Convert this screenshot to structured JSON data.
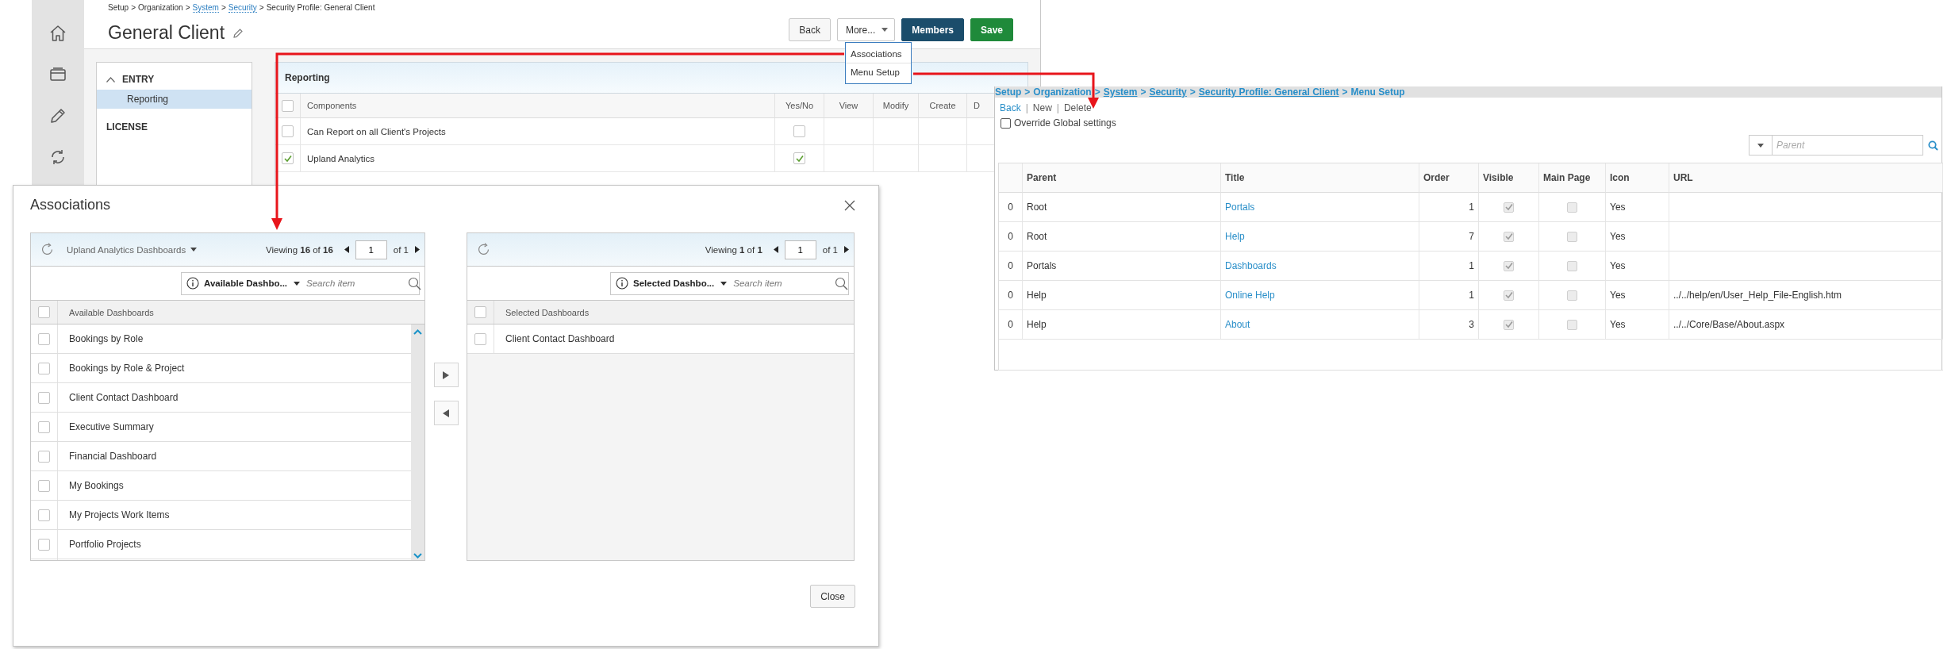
{
  "app": {
    "breadcrumb": {
      "separator": ">",
      "items": [
        {
          "text": "Setup",
          "link": false
        },
        {
          "text": "Organization",
          "link": false
        },
        {
          "text": "System",
          "link": true
        },
        {
          "text": "Security",
          "link": true
        },
        {
          "text": "Security Profile: General Client",
          "link": false
        }
      ]
    },
    "title": "General Client",
    "buttons": [
      {
        "label": "Back",
        "kind": "default"
      },
      {
        "label": "More...",
        "kind": "dropdown"
      },
      {
        "label": "Members",
        "kind": "primary"
      },
      {
        "label": "Save",
        "kind": "success"
      }
    ],
    "more_menu": [
      "Associations",
      "Menu Setup"
    ],
    "nav": [
      {
        "label": "ENTRY",
        "expanded": true,
        "children": [
          {
            "label": "Reporting",
            "selected": true
          }
        ]
      },
      {
        "label": "LICENSE"
      }
    ],
    "panel": {
      "title": "Reporting",
      "all_checked": false,
      "columns": [
        "Components",
        "Yes/No",
        "View",
        "Modify",
        "Create",
        "D"
      ],
      "rows": [
        {
          "name": "Can Report on all Client's Projects",
          "checked": false,
          "yes_no": false
        },
        {
          "name": "Upland Analytics",
          "checked": true,
          "yes_no": true
        }
      ]
    }
  },
  "associations": {
    "title": "Associations",
    "panes": [
      {
        "kind": "source",
        "category": "Upland Analytics Dashboards",
        "viewing": "Viewing **16** of **16**",
        "page": "1",
        "page_total": "of 1",
        "filter": "Available Dashbo...",
        "search": {
          "placeholder": "Search item"
        },
        "column": "Available Dashboards",
        "all_checked": false,
        "items": [
          {
            "label": "Bookings by Role",
            "checked": false
          },
          {
            "label": "Bookings by Role & Project",
            "checked": false
          },
          {
            "label": "Client Contact Dashboard",
            "checked": false
          },
          {
            "label": "Executive Summary",
            "checked": false
          },
          {
            "label": "Financial Dashboard",
            "checked": false
          },
          {
            "label": "My Bookings",
            "checked": false
          },
          {
            "label": "My Projects Work Items",
            "checked": false
          },
          {
            "label": "Portfolio Projects",
            "checked": false
          }
        ]
      },
      {
        "kind": "target",
        "viewing": "Viewing **1** of **1**",
        "page": "1",
        "page_total": "of 1",
        "filter": "Selected Dashbo...",
        "search": {
          "placeholder": "Search item"
        },
        "column": "Selected Dashboards",
        "all_checked": false,
        "items": [
          {
            "label": "Client Contact Dashboard",
            "checked": false
          }
        ]
      }
    ],
    "close": "Close"
  },
  "menu_setup": {
    "breadcrumb": {
      "separator": ">",
      "items": [
        {
          "text": "Setup",
          "link": false
        },
        {
          "text": "Organization",
          "link": false
        },
        {
          "text": "System",
          "link": true
        },
        {
          "text": "Security",
          "link": true
        },
        {
          "text": "Security Profile: General Client",
          "link": true
        },
        {
          "text": "Menu Setup",
          "link": false
        }
      ]
    },
    "actions": {
      "separator": "|",
      "items": [
        {
          "label": "Back",
          "kind": "link"
        },
        {
          "label": "New",
          "kind": "plain"
        },
        {
          "label": "Delete",
          "kind": "plain"
        }
      ]
    },
    "override": {
      "label": "Override Global settings",
      "checked": false
    },
    "filter": {
      "placeholder": "Parent"
    },
    "columns": [
      "Parent",
      "Title",
      "Order",
      "Visible",
      "Main Page",
      "Icon",
      "URL"
    ],
    "rows": [
      {
        "number": "0",
        "parent": "Root",
        "title": "Portals",
        "order": "1",
        "visible": true,
        "main_page": false,
        "icon": "Yes"
      },
      {
        "number": "0",
        "parent": "Root",
        "title": "Help",
        "order": "7",
        "visible": true,
        "main_page": false,
        "icon": "Yes"
      },
      {
        "number": "0",
        "parent": "Portals",
        "title": "Dashboards",
        "order": "1",
        "visible": true,
        "main_page": false,
        "icon": "Yes"
      },
      {
        "number": "0",
        "parent": "Help",
        "title": "Online Help",
        "order": "1",
        "visible": true,
        "main_page": false,
        "icon": "Yes",
        "url": "../../help/en/User_Help_File-English.htm"
      },
      {
        "number": "0",
        "parent": "Help",
        "title": "About",
        "order": "3",
        "visible": true,
        "main_page": false,
        "icon": "Yes",
        "url": "../../Core/Base/About.aspx"
      }
    ]
  }
}
